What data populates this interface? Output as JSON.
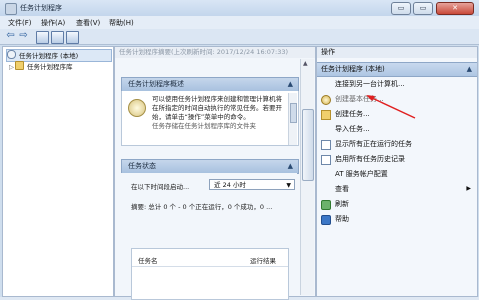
{
  "window": {
    "title": "任务计划程序",
    "controls": {
      "minimize": "▭",
      "maximize": "▭",
      "close": "✕"
    }
  },
  "menu": [
    {
      "label": "文件(F)"
    },
    {
      "label": "操作(A)"
    },
    {
      "label": "查看(V)"
    },
    {
      "label": "帮助(H)"
    }
  ],
  "toolbar": {
    "back": "⇦",
    "forward": "⇨"
  },
  "tree": {
    "items": [
      {
        "label": "任务计划程序 (本地)",
        "selected": true,
        "icon": "clock-icon"
      },
      {
        "label": "任务计划程序库",
        "selected": false,
        "icon": "folder-icon",
        "expander": "▷"
      }
    ]
  },
  "center": {
    "header": "任务计划程序摘要(上次刷新时间: 2017/12/24 16:07:33)",
    "overview": {
      "title": "任务计划程序概述",
      "collapse": "▲",
      "text": "可以使用任务计划程序来创建和管理计算机将在所指定的时间自动执行的常见任务。若要开始，请单击“操作”菜单中的命令。",
      "text_more": "任务存储在任务计划程序库的文件夹"
    },
    "status": {
      "title": "任务状态",
      "collapse": "▲",
      "period_label": "在以下时间段启动...",
      "period_value": "近 24 小时",
      "summary": "摘要: 总计 0 个 - 0 个正在运行，0 个成功，0 ...",
      "columns": [
        "任务名",
        "运行结果"
      ]
    }
  },
  "actions": {
    "header": "操作",
    "group": "任务计划程序 (本地)",
    "collapse": "▲",
    "items": [
      {
        "label": "连接到另一台计算机...",
        "icon": "blank"
      },
      {
        "label": "创建基本任务...",
        "icon": "gear-icon"
      },
      {
        "label": "创建任务...",
        "icon": "folder-icon"
      },
      {
        "label": "导入任务...",
        "icon": "blank"
      },
      {
        "label": "显示所有正在运行的任务",
        "icon": "list-icon"
      },
      {
        "label": "启用所有任务历史记录",
        "icon": "list-icon"
      },
      {
        "label": "AT 服务帐户配置",
        "icon": "blank"
      },
      {
        "label": "查看",
        "icon": "blank",
        "submenu": "▶"
      },
      {
        "label": "刷新",
        "icon": "refresh-icon"
      },
      {
        "label": "帮助",
        "icon": "help-icon"
      }
    ]
  },
  "colors": {
    "annotation_arrow": "#e02020",
    "accent": "#aec6e3"
  }
}
